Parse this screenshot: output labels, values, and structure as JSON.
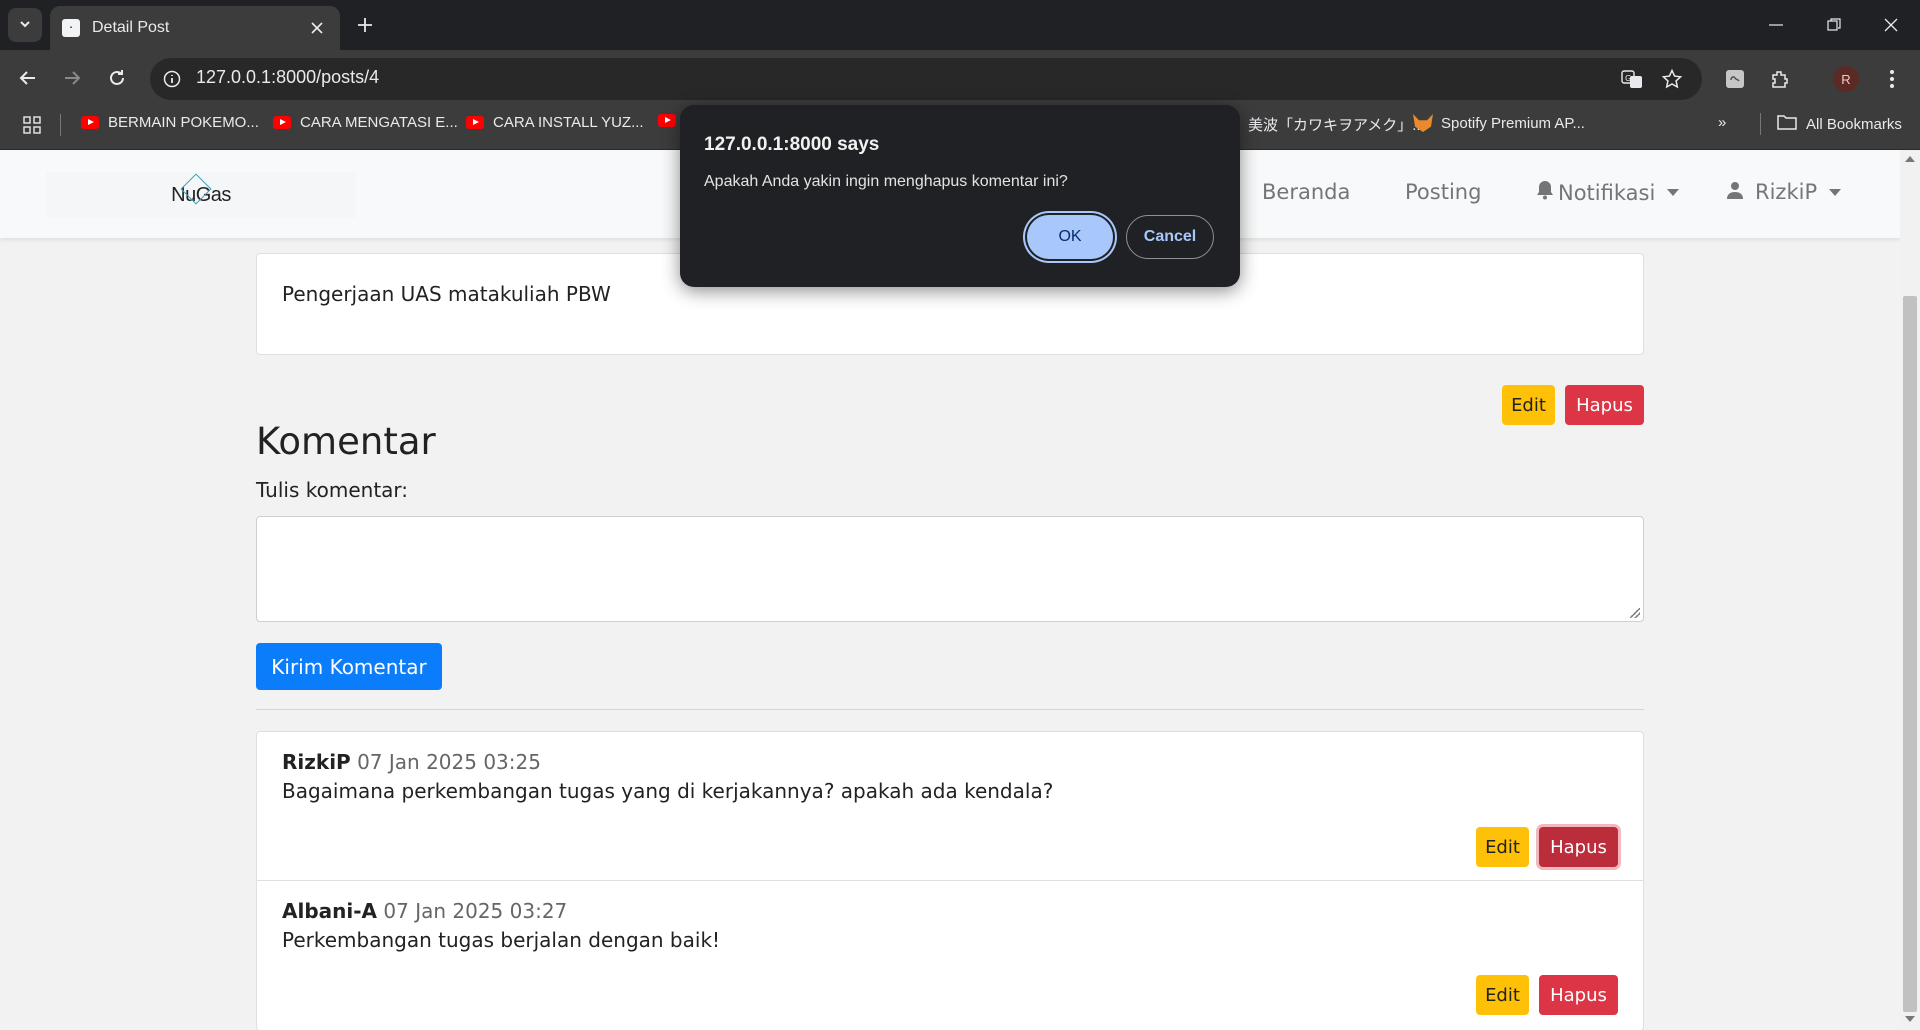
{
  "browser": {
    "tab_title": "Detail Post",
    "url": "127.0.0.1:8000/posts/4",
    "avatar_initial": "R",
    "bookmarks": [
      {
        "label": "BERMAIN POKEMO..."
      },
      {
        "label": "CARA MENGATASI E..."
      },
      {
        "label": "CARA INSTALL YUZ..."
      },
      {
        "label": "美波「カワキヲアメク」..."
      },
      {
        "label": "Spotify Premium AP..."
      }
    ],
    "all_bookmarks": "All Bookmarks"
  },
  "navbar": {
    "brand": "NuGas",
    "links": [
      {
        "label": "Beranda"
      },
      {
        "label": "Posting"
      },
      {
        "label": "Notifikasi"
      },
      {
        "label": "RizkiP"
      }
    ]
  },
  "post": {
    "body": "Pengerjaan UAS matakuliah PBW",
    "edit_label": "Edit",
    "delete_label": "Hapus"
  },
  "comments_section": {
    "title": "Komentar",
    "input_label": "Tulis komentar:",
    "textarea_value": "",
    "submit_label": "Kirim Komentar",
    "items": [
      {
        "author": "RizkiP",
        "time": "07 Jan 2025 03:25",
        "text": "Bagaimana perkembangan tugas yang di kerjakannya? apakah ada kendala?",
        "edit_label": "Edit",
        "delete_label": "Hapus"
      },
      {
        "author": "Albani-A",
        "time": "07 Jan 2025 03:27",
        "text": "Perkembangan tugas berjalan dengan baik!",
        "edit_label": "Edit",
        "delete_label": "Hapus"
      }
    ]
  },
  "dialog": {
    "title": "127.0.0.1:8000 says",
    "message": "Apakah Anda yakin ingin menghapus komentar ini?",
    "ok_label": "OK",
    "cancel_label": "Cancel"
  },
  "colors": {
    "primary": "#0b7dfb",
    "warning": "#ffc107",
    "danger": "#dc3545",
    "dialog_bg": "#202124",
    "dialog_accent": "#a8c7fa"
  }
}
